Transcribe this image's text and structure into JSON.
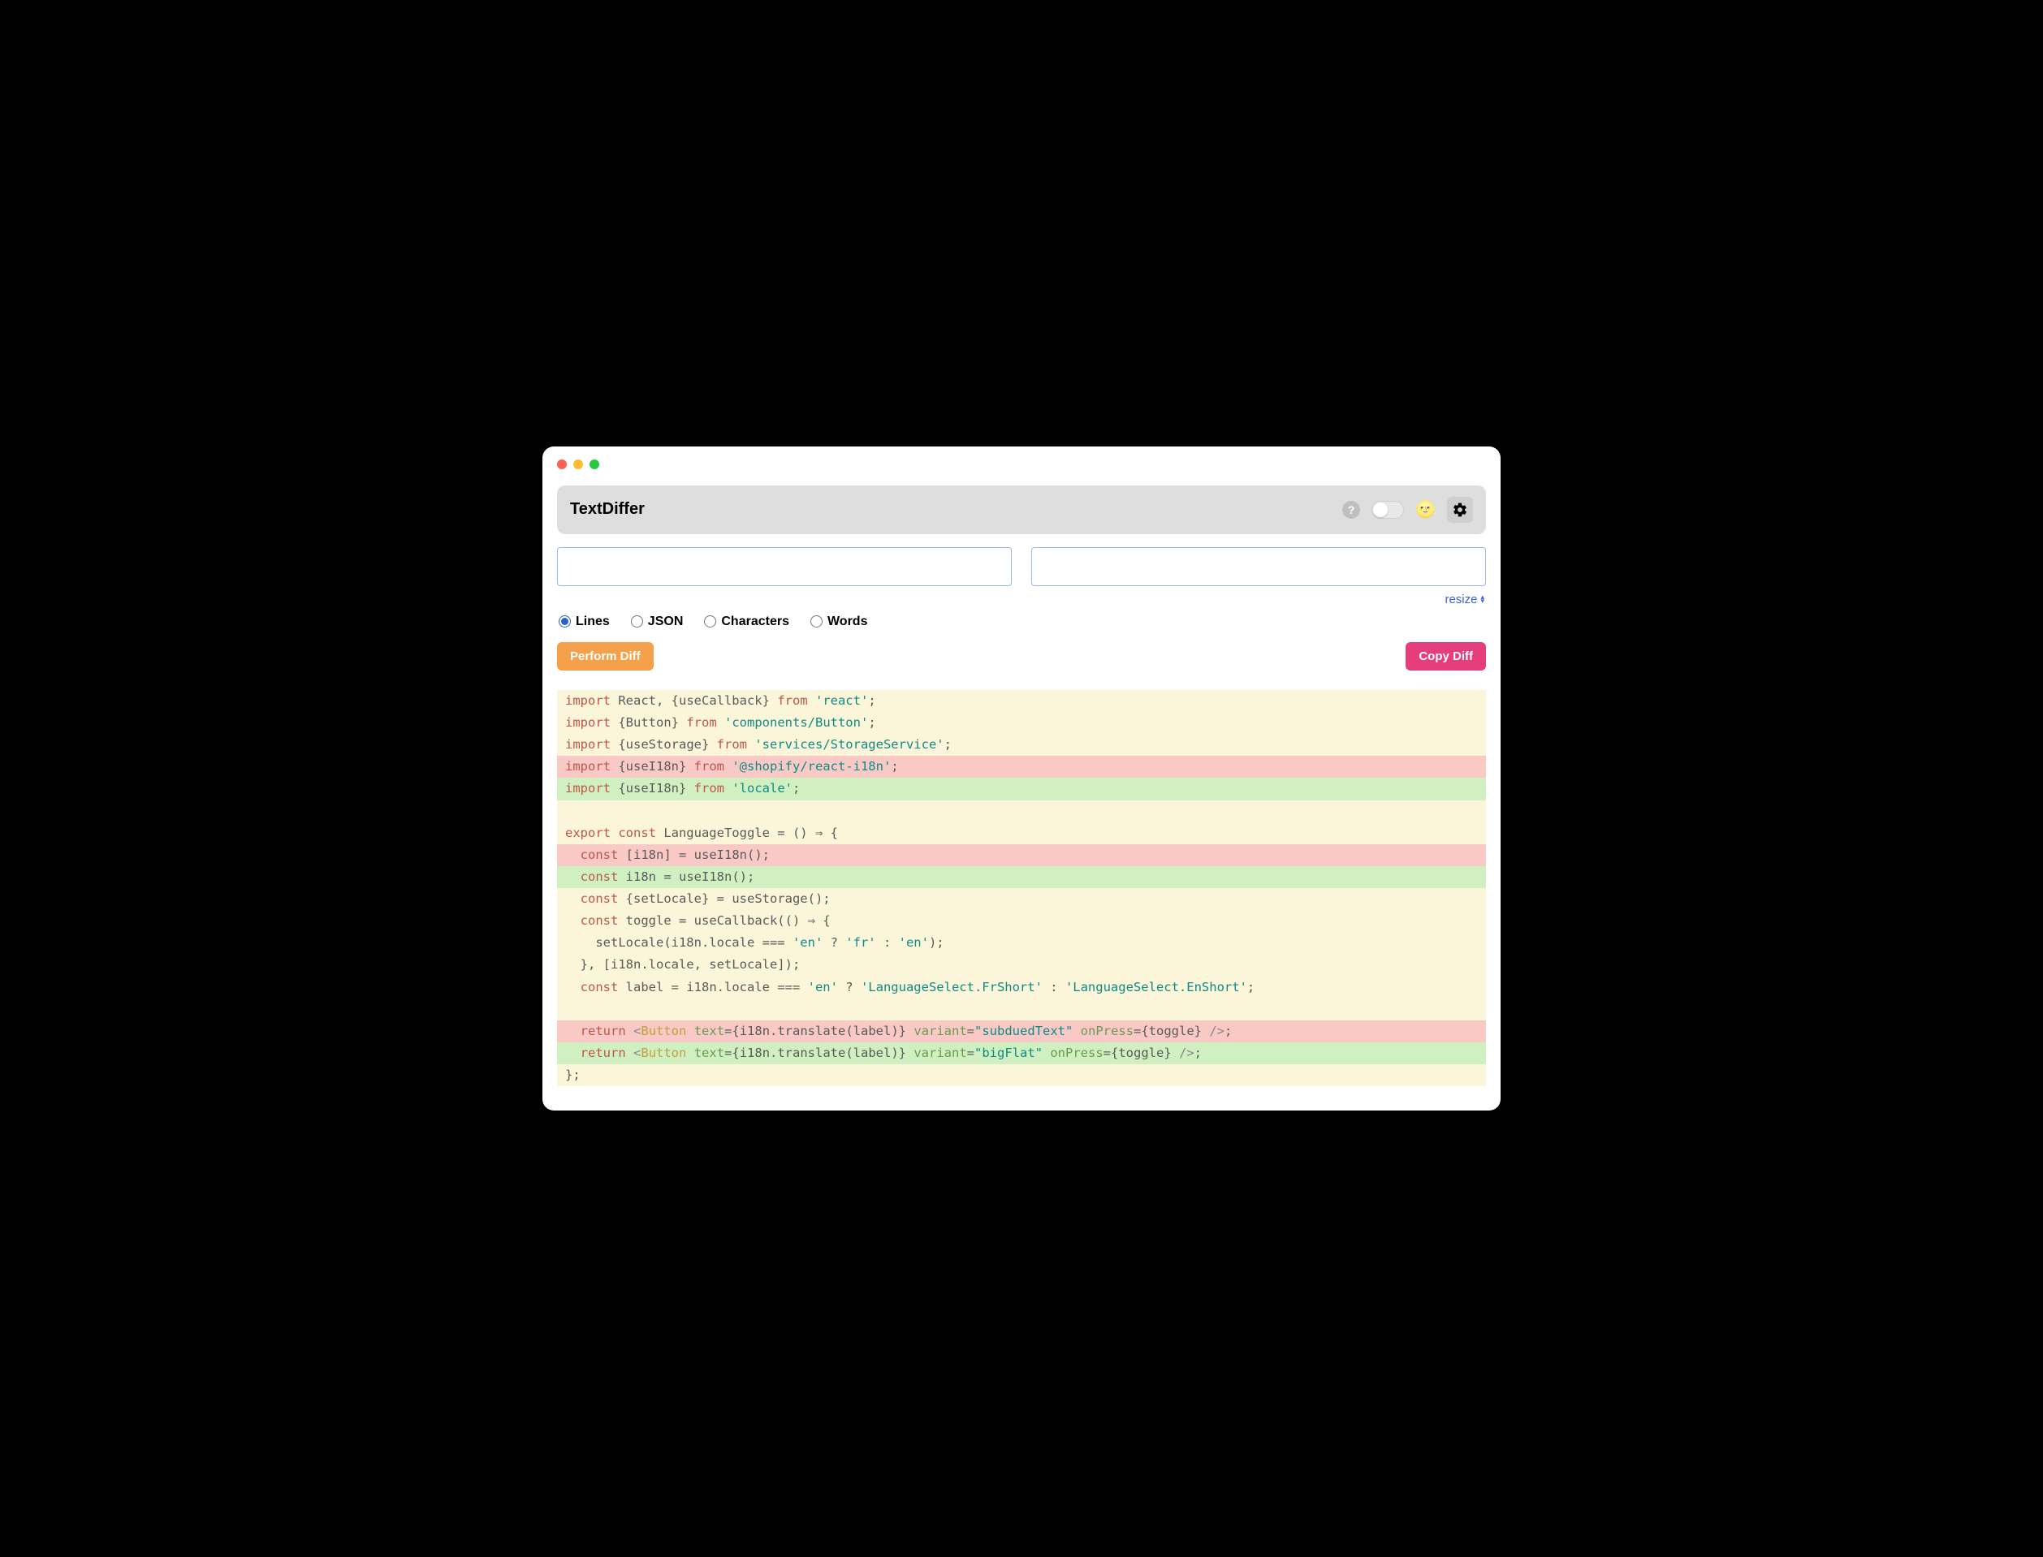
{
  "header": {
    "title": "TextDiffer",
    "help_glyph": "?",
    "face_emoji": "🌝"
  },
  "inputs": {
    "left_value": "",
    "right_value": ""
  },
  "resize_label": "resize",
  "modes": {
    "lines": "Lines",
    "json": "JSON",
    "characters": "Characters",
    "words": "Words",
    "selected": "lines"
  },
  "buttons": {
    "perform": "Perform Diff",
    "copy": "Copy Diff"
  },
  "diff": {
    "lines": [
      {
        "type": "ctx",
        "tokens": [
          [
            "kw",
            "import"
          ],
          [
            "plain",
            " React, {useCallback} "
          ],
          [
            "kw",
            "from"
          ],
          [
            "plain",
            " "
          ],
          [
            "str",
            "'react'"
          ],
          [
            "plain",
            ";"
          ]
        ]
      },
      {
        "type": "ctx",
        "tokens": [
          [
            "kw",
            "import"
          ],
          [
            "plain",
            " {Button} "
          ],
          [
            "kw",
            "from"
          ],
          [
            "plain",
            " "
          ],
          [
            "str",
            "'components/Button'"
          ],
          [
            "plain",
            ";"
          ]
        ]
      },
      {
        "type": "ctx",
        "tokens": [
          [
            "kw",
            "import"
          ],
          [
            "plain",
            " {useStorage} "
          ],
          [
            "kw",
            "from"
          ],
          [
            "plain",
            " "
          ],
          [
            "str",
            "'services/StorageService'"
          ],
          [
            "plain",
            ";"
          ]
        ]
      },
      {
        "type": "del",
        "tokens": [
          [
            "kw",
            "import"
          ],
          [
            "plain",
            " {useI18n} "
          ],
          [
            "kw",
            "from"
          ],
          [
            "plain",
            " "
          ],
          [
            "str",
            "'@shopify/react-i18n'"
          ],
          [
            "plain",
            ";"
          ]
        ]
      },
      {
        "type": "add",
        "tokens": [
          [
            "kw",
            "import"
          ],
          [
            "plain",
            " {useI18n} "
          ],
          [
            "kw",
            "from"
          ],
          [
            "plain",
            " "
          ],
          [
            "str",
            "'locale'"
          ],
          [
            "plain",
            ";"
          ]
        ]
      },
      {
        "type": "ctx",
        "tokens": [
          [
            "plain",
            " "
          ]
        ]
      },
      {
        "type": "ctx",
        "tokens": [
          [
            "kw",
            "export const"
          ],
          [
            "plain",
            " LanguageToggle = () ⇒ {"
          ]
        ]
      },
      {
        "type": "del",
        "tokens": [
          [
            "plain",
            "  "
          ],
          [
            "kw",
            "const"
          ],
          [
            "plain",
            " [i18n] = useI18n();"
          ]
        ]
      },
      {
        "type": "add",
        "tokens": [
          [
            "plain",
            "  "
          ],
          [
            "kw",
            "const"
          ],
          [
            "plain",
            " i18n = useI18n();"
          ]
        ]
      },
      {
        "type": "ctx",
        "tokens": [
          [
            "plain",
            "  "
          ],
          [
            "kw",
            "const"
          ],
          [
            "plain",
            " {setLocale} = useStorage();"
          ]
        ]
      },
      {
        "type": "ctx",
        "tokens": [
          [
            "plain",
            "  "
          ],
          [
            "kw",
            "const"
          ],
          [
            "plain",
            " toggle = useCallback(() ⇒ {"
          ]
        ]
      },
      {
        "type": "ctx",
        "tokens": [
          [
            "plain",
            "    setLocale(i18n.locale === "
          ],
          [
            "str",
            "'en'"
          ],
          [
            "plain",
            " ? "
          ],
          [
            "str",
            "'fr'"
          ],
          [
            "plain",
            " : "
          ],
          [
            "str",
            "'en'"
          ],
          [
            "plain",
            ");"
          ]
        ]
      },
      {
        "type": "ctx",
        "tokens": [
          [
            "plain",
            "  }, [i18n.locale, setLocale]);"
          ]
        ]
      },
      {
        "type": "ctx",
        "tokens": [
          [
            "plain",
            "  "
          ],
          [
            "kw",
            "const"
          ],
          [
            "plain",
            " label = i18n.locale === "
          ],
          [
            "str",
            "'en'"
          ],
          [
            "plain",
            " ? "
          ],
          [
            "str",
            "'LanguageSelect.FrShort'"
          ],
          [
            "plain",
            " : "
          ],
          [
            "str",
            "'LanguageSelect.EnShort'"
          ],
          [
            "plain",
            ";"
          ]
        ]
      },
      {
        "type": "ctx",
        "tokens": [
          [
            "plain",
            " "
          ]
        ]
      },
      {
        "type": "del",
        "tokens": [
          [
            "plain",
            "  "
          ],
          [
            "kw",
            "return"
          ],
          [
            "plain",
            " "
          ],
          [
            "punc",
            "<"
          ],
          [
            "comp",
            "Button"
          ],
          [
            "plain",
            " "
          ],
          [
            "attr",
            "text"
          ],
          [
            "plain",
            "={i18n.translate(label)} "
          ],
          [
            "attr",
            "variant"
          ],
          [
            "plain",
            "="
          ],
          [
            "str",
            "\"subduedText\""
          ],
          [
            "plain",
            " "
          ],
          [
            "attr",
            "onPress"
          ],
          [
            "plain",
            "={toggle} "
          ],
          [
            "punc",
            "/>"
          ],
          [
            "plain",
            ";"
          ]
        ]
      },
      {
        "type": "add",
        "tokens": [
          [
            "plain",
            "  "
          ],
          [
            "kw",
            "return"
          ],
          [
            "plain",
            " "
          ],
          [
            "punc",
            "<"
          ],
          [
            "comp",
            "Button"
          ],
          [
            "plain",
            " "
          ],
          [
            "attr",
            "text"
          ],
          [
            "plain",
            "={i18n.translate(label)} "
          ],
          [
            "attr",
            "variant"
          ],
          [
            "plain",
            "="
          ],
          [
            "str",
            "\"bigFlat\""
          ],
          [
            "plain",
            " "
          ],
          [
            "attr",
            "onPress"
          ],
          [
            "plain",
            "={toggle} "
          ],
          [
            "punc",
            "/>"
          ],
          [
            "plain",
            ";"
          ]
        ]
      },
      {
        "type": "ctx",
        "tokens": [
          [
            "plain",
            "};"
          ]
        ]
      }
    ]
  }
}
